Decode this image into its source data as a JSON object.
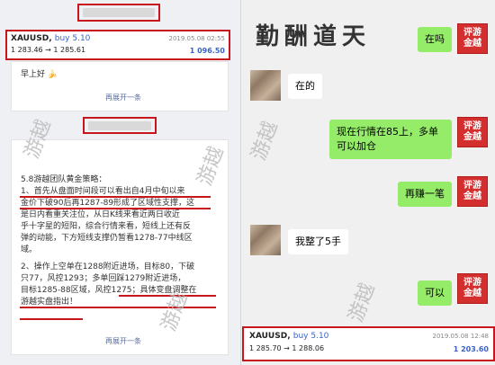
{
  "left": {
    "trade": {
      "symbol": "XAUUSD,",
      "side": "buy 5.10",
      "date": "2019.05.08 02:55",
      "price": "1 283.46 → 1 285.61",
      "profit": "1 096.50"
    },
    "greeting": "早上好",
    "greeting_icon": "banana-icon",
    "expand1": "再展开一条",
    "strategy": [
      "5.8游越团队黄金策略：",
      "1、首先从盘面时间段可以看出自4月中旬以来",
      "金价下破90后再1287-89形成了区域性支撑，这",
      "是日内看重关注位，从日K线来看近两日收近",
      "乎十字星的短阳，综合行情来看，短线上还有反",
      "弹的动能，下方短线支撑仍暂看1278-77中线区",
      "域。",
      "",
      "2、操作上空单在1288附近进场，目标80，下破",
      "只77，风控1293；多单回踩1279附近进场，",
      "目标1285-88区域，风控1275；具体变盘调整在",
      "游越实盘指出！"
    ],
    "expand2": "再展开一条",
    "watermark": "游越"
  },
  "right": {
    "brand": "勤酬道天",
    "messages": [
      {
        "from": "me",
        "text": "在吗"
      },
      {
        "from": "other",
        "text": "在的"
      },
      {
        "from": "me",
        "text": "现在行情在85上，多单可以加仓"
      },
      {
        "from": "me",
        "text": "再赚一笔"
      },
      {
        "from": "other",
        "text": "我整了5手"
      },
      {
        "from": "me",
        "text": "可以"
      }
    ],
    "avatar_text": "评游\n金越",
    "trade": {
      "symbol": "XAUUSD,",
      "side": "buy 5.10",
      "date": "2019.05.08 12:48",
      "price": "1 285.70 → 1 288.06",
      "profit": "1 203.60"
    },
    "watermark": "游越"
  }
}
